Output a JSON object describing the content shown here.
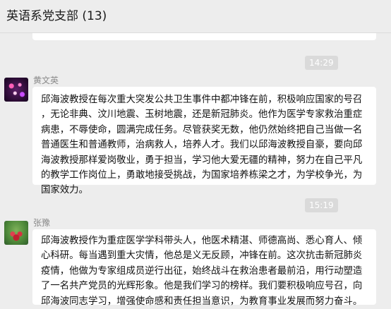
{
  "chat": {
    "title": "英语系党支部 (13)"
  },
  "messages": [
    {
      "time": "14:29",
      "sender": "黄文英",
      "text": "邱海波教授在每次重大突发公共卫生事件中都冲锋在前，积极响应国家的号召\n，无论非典、汶川地震、玉树地震，还是新冠肺炎。他作为医学专家救治重症\n病患，不辱使命，圆满完成任务。尽管获奖无数，他仍然始终把自己当做一名\n普通医生和普通教师，治病救人，培养人才。我们以邱海波教授自豪，要向邱\n海波教授那样爱岗敬业，勇于担当，学习他大爱无疆的精神，努力在自己平凡\n的教学工作岗位上，勇敢地接受挑战，为国家培养栋梁之才，为学校争光，为\n国家效力。"
    },
    {
      "time": "15:19",
      "sender": "张豫",
      "text": "邱海波教授作为重症医学学科带头人，他医术精湛、师德高尚、悉心育人、倾\n心科研。每当遇到重大灾情，他总是义无反顾，冲锋在前。这次抗击新冠肺炎\n疫情，他做为专家组成员逆行出征，始终战斗在救治患者最前沿，用行动塑造\n了一名共产党员的光辉形象。他是我们学习的榜样。我们要积极响应号召，向\n邱海波同志学习，增强使命感和责任担当意识，为教育事业发展而努力奋斗。"
    }
  ],
  "colors": {
    "background": "#ededed",
    "bubble": "#ffffff",
    "time_pill": "#dadada",
    "sender_name": "#8a8a8a"
  }
}
